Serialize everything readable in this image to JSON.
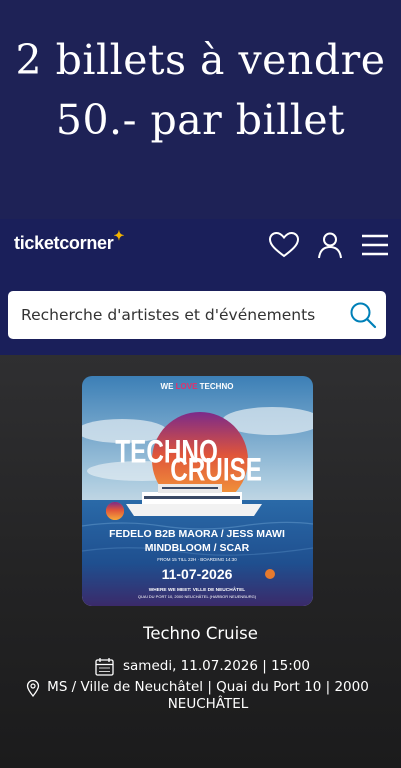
{
  "overlay": {
    "line1": "2 billets à vendre",
    "line2": "50.- par billet"
  },
  "header": {
    "logo_text": "ticketcorner",
    "logo_star": "✦",
    "icons": [
      "heart-icon",
      "user-icon",
      "hamburger-menu-icon"
    ]
  },
  "search": {
    "placeholder": "Recherche d'artistes et d'événements",
    "icon": "search-icon"
  },
  "poster": {
    "top_tag_we": "WE",
    "top_tag_love": "LOVE",
    "top_tag_techno": "TECHNO",
    "title_word1": "TECHNO",
    "title_word2": "CRUISE",
    "lineup1": "FEDELO B2B MAORA / JESS MAWI",
    "lineup2": "MINDBLOOM / SCAR",
    "times": "FROM 15 TILL 22H  ·  BOARDING 14:30",
    "date": "11-07-2026",
    "meet": "WHERE WE MEET: VILLE DE NEUCHÂTEL",
    "address": "QUAI DU PORT 10, 2000 NEUCHÂTEL (HARBOR NEUENBURG)"
  },
  "event": {
    "title": "Techno Cruise",
    "datetime": "samedi, 11.07.2026 | 15:00",
    "venue": "MS / Ville de Neuchâtel | Quai du Port 10 | 2000 NEUCHÂTEL"
  },
  "colors": {
    "overlay_bg": "#1e2256",
    "header_bg": "#1a1f5a",
    "search_icon": "#0080b8",
    "logo_star": "#f4b400",
    "content_bg": "#2a2a2b"
  }
}
